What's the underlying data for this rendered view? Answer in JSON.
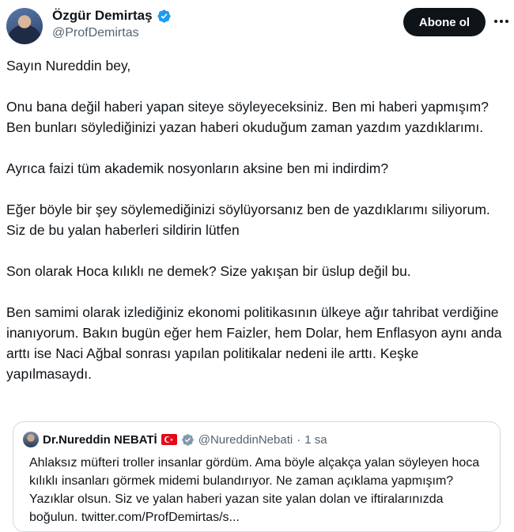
{
  "author": {
    "name": "Özgür Demirtaş",
    "handle": "@ProfDemirtas",
    "follow_label": "Abone ol",
    "avatar_icon": "avatar",
    "verified_color": "#1d9bf0"
  },
  "tweet": {
    "paragraphs": [
      "Sayın Nureddin bey,",
      "Onu bana değil haberi yapan siteye söyleyeceksiniz. Ben mi haberi yapmışım? Ben bunları söylediğinizi yazan haberi okuduğum zaman yazdım yazdıklarımı.",
      "Ayrıca faizi tüm akademik nosyonların aksine ben mi indirdim?",
      "Eğer böyle bir şey söylemediğinizi söylüyorsanız ben de yazdıklarımı siliyorum. Siz de bu yalan haberleri sildirin lütfen",
      "Son olarak Hoca kılıklı ne demek? Size yakışan bir üslup değil bu.",
      "Ben samimi olarak izlediğiniz ekonomi politikasının ülkeye ağır tahribat verdiğine inanıyorum.  Bakın bugün eğer hem Faizler, hem Dolar, hem Enflasyon aynı anda arttı ise Naci Ağbal sonrası yapılan politikalar nedeni ile arttı. Keşke yapılmasaydı."
    ]
  },
  "quote": {
    "name": "Dr.Nureddin NEBATİ",
    "handle": "@NureddinNebati",
    "separator": "·",
    "time": "1 sa",
    "text": "Ahlaksız müfteri troller insanlar gördüm. Ama böyle alçakça yalan söyleyen hoca kılıklı insanları görmek midemi bulandırıyor. Ne zaman açıklama yapmışım? Yazıklar olsun. Siz ve yalan haberi yazan site yalan dolan ve iftiralarınızda boğulun. twitter.com/ProfDemirtas/s..."
  }
}
